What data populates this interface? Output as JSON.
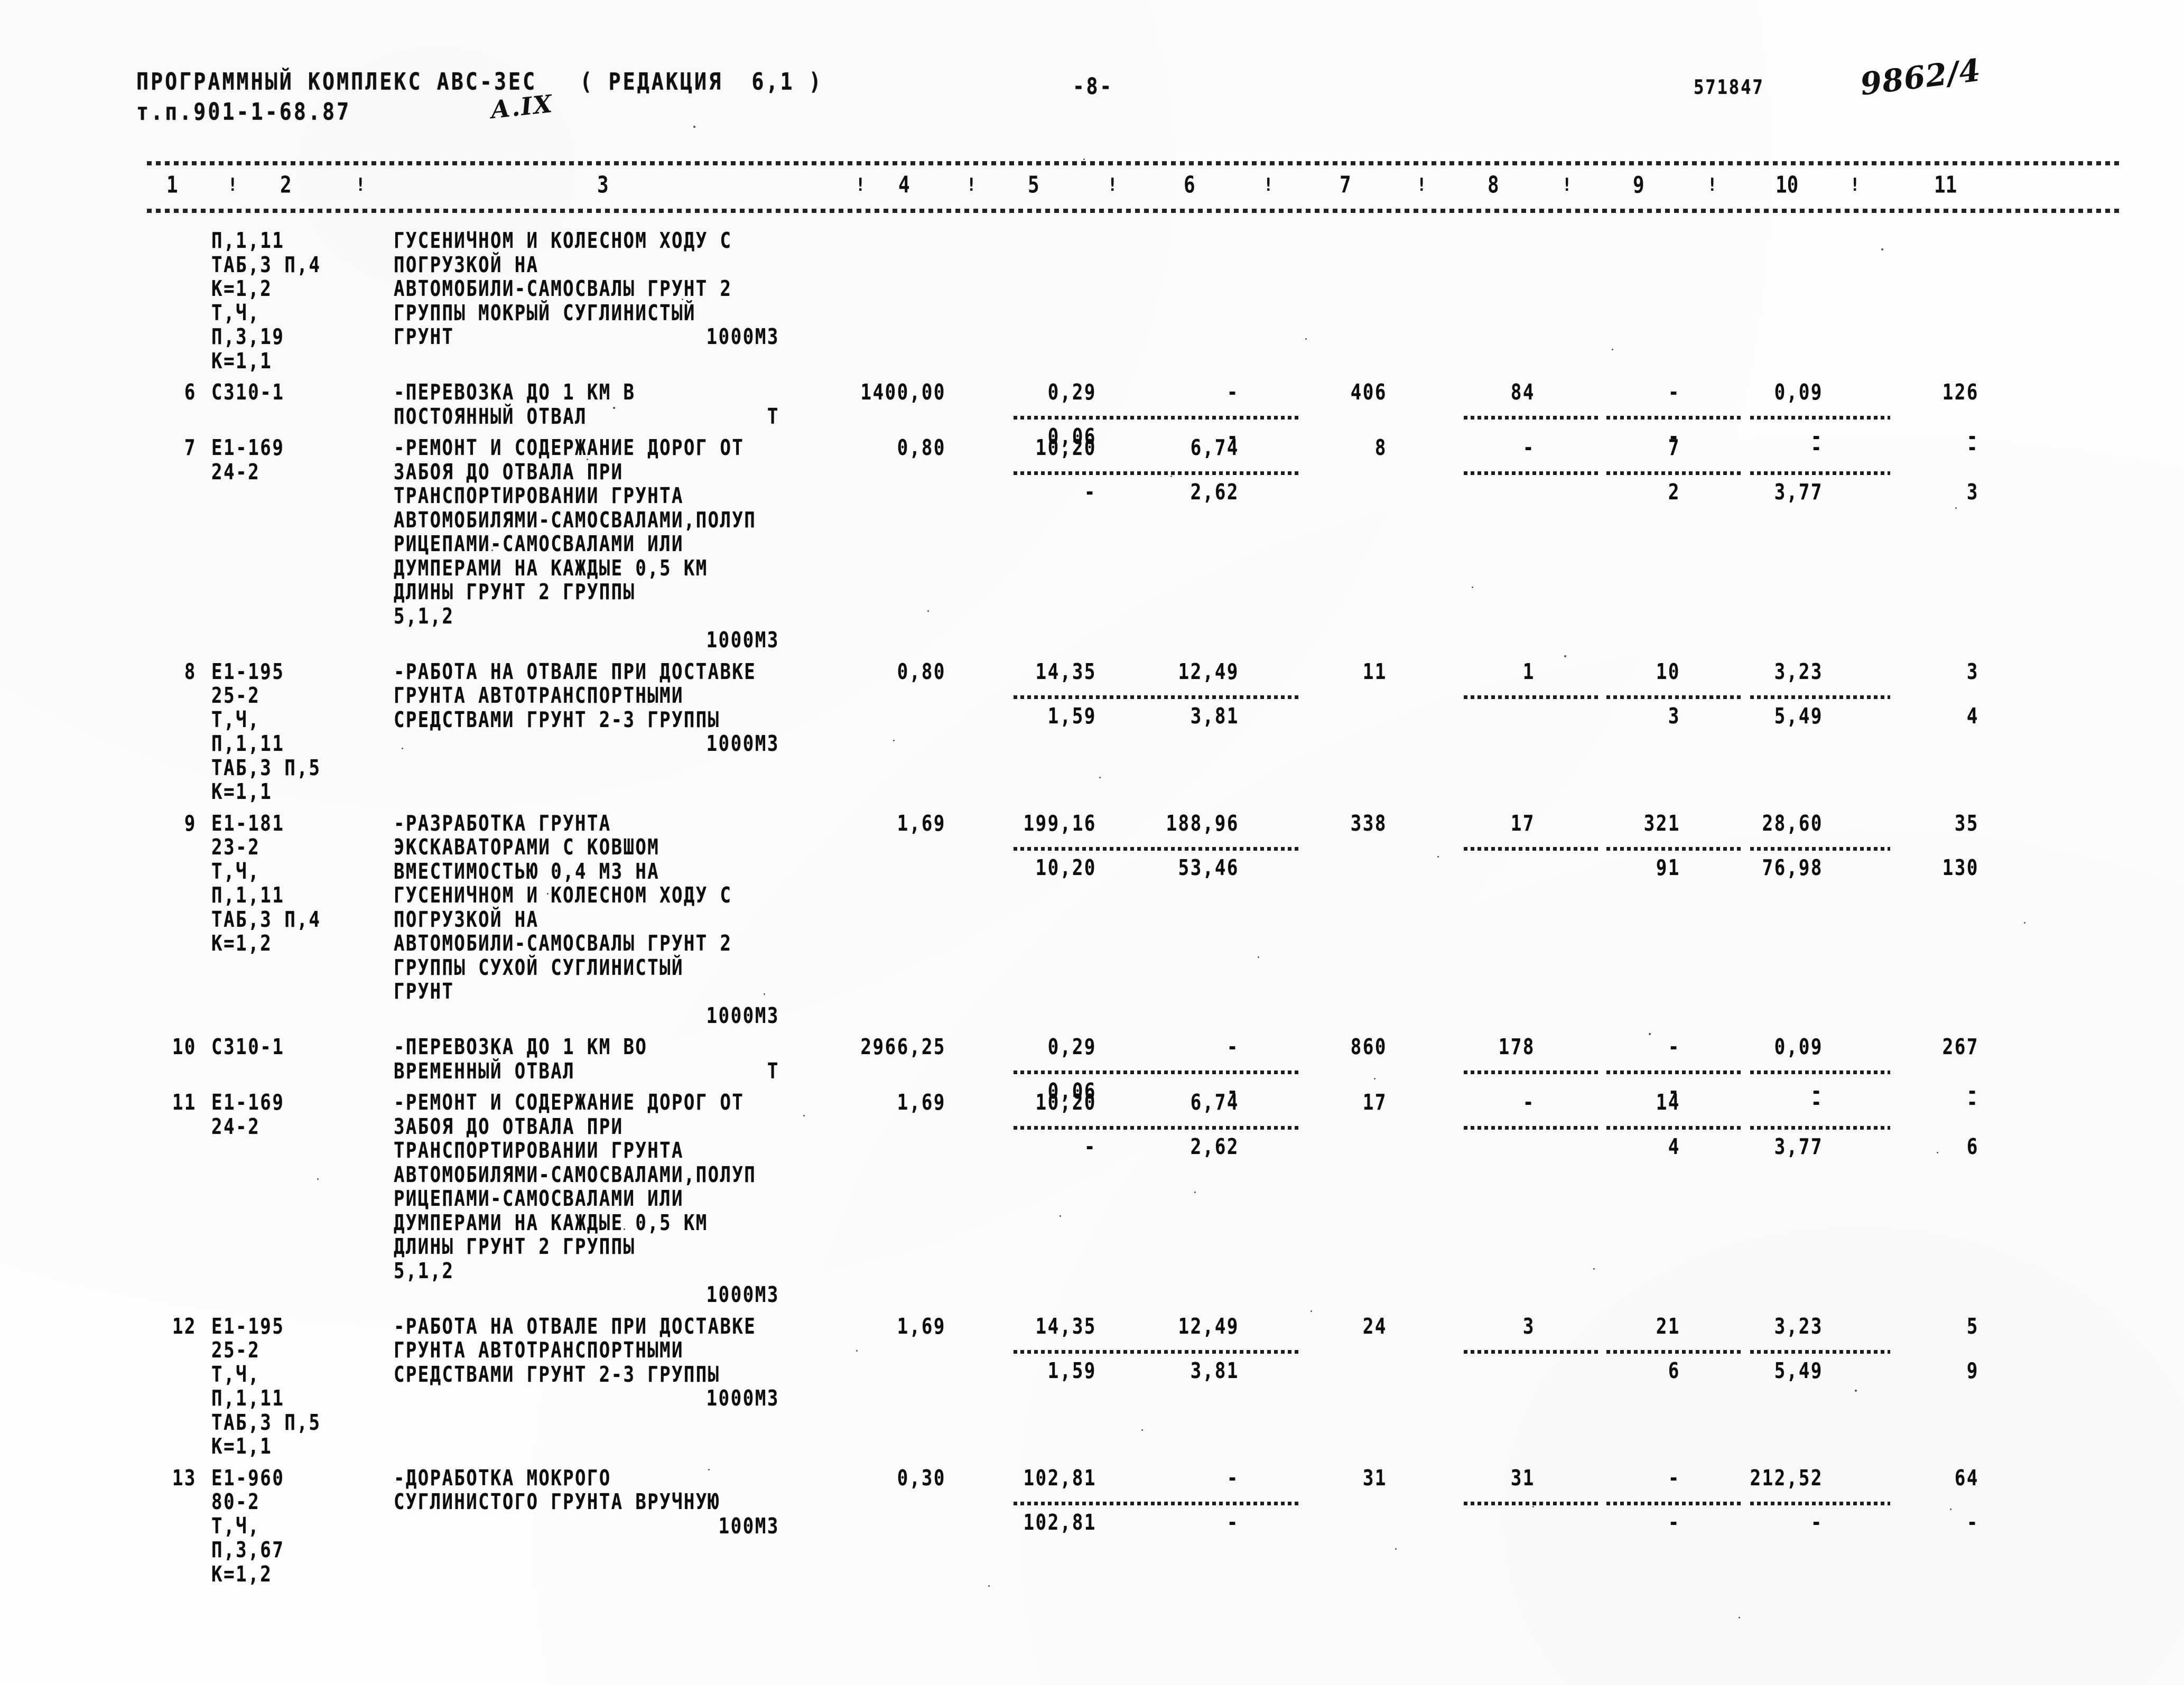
{
  "header": {
    "program_title": "ПРОГРАММНЫЙ КОМПЛЕКС АВС-ЗЕС   ( РЕДАКЦИЯ  6,1 )",
    "project_code": "т.п.901-1-68.87",
    "handwritten_section": "А.IX",
    "page_label": "-8-",
    "doc_number": "571847",
    "handwritten_number": "9862/4"
  },
  "columns": {
    "numbers": [
      "1",
      "2",
      "3",
      "4",
      "5",
      "6",
      "7",
      "8",
      "9",
      "10",
      "11"
    ],
    "separator": "!"
  },
  "rows": [
    {
      "no": "",
      "code_lines": [
        "П,1,11",
        "ТАБ,3 П,4",
        "К=1,2",
        "Т,Ч,",
        "П,3,19",
        "К=1,1"
      ],
      "desc_lines": [
        "ГУСЕНИЧНОМ И КОЛЕСНОМ ХОДУ С",
        "ПОГРУЗКОЙ НА",
        "АВТОМОБИЛИ-САМОСВАЛЫ ГРУНТ 2",
        "ГРУППЫ МОКРЫЙ СУГЛИНИСТЫЙ",
        "ГРУНТ",
        ""
      ],
      "unit": "1000М3",
      "unit_line": 5,
      "values": [],
      "sub_values": [],
      "has_rules": false
    },
    {
      "no": "6",
      "code_lines": [
        "С310-1"
      ],
      "desc_lines": [
        "-ПЕРЕВОЗКА ДО 1 КМ В",
        "ПОСТОЯННЫЙ ОТВАЛ"
      ],
      "unit": "Т",
      "unit_line": 2,
      "values": [
        "1400,00",
        "0,29",
        "-",
        "406",
        "84",
        "-",
        "0,09",
        "126"
      ],
      "sub_values": [
        "",
        "0,06",
        "-",
        "",
        "",
        "-",
        "-",
        "-"
      ],
      "has_rules": true
    },
    {
      "no": "7",
      "code_lines": [
        "Е1-169",
        "24-2"
      ],
      "desc_lines": [
        "-РЕМОНТ И СОДЕРЖАНИЕ ДОРОГ ОТ",
        "ЗАБОЯ ДО ОТВАЛА ПРИ",
        "ТРАНСПОРТИРОВАНИИ ГРУНТА",
        "АВТОМОБИЛЯМИ-САМОСВАЛАМИ,ПОЛУП",
        "РИЦЕПАМИ-САМОСВАЛАМИ ИЛИ",
        "ДУМПЕРАМИ НА КАЖДЫЕ 0,5 КМ",
        "ДЛИНЫ ГРУНТ 2 ГРУППЫ",
        "5,1,2"
      ],
      "unit": "1000М3",
      "unit_line": 9,
      "values": [
        "0,80",
        "10,20",
        "6,74",
        "8",
        "-",
        "7",
        "-",
        "-"
      ],
      "sub_values": [
        "",
        "-",
        "2,62",
        "",
        "",
        "2",
        "3,77",
        "3"
      ],
      "has_rules": true
    },
    {
      "no": "8",
      "code_lines": [
        "Е1-195",
        "25-2",
        "Т,Ч,",
        "П,1,11",
        "ТАБ,3 П,5",
        "К=1,1"
      ],
      "desc_lines": [
        "-РАБОТА НА ОТВАЛЕ ПРИ ДОСТАВКЕ",
        "ГРУНТА АВТОТРАНСПОРТНЫМИ",
        "СРЕДСТВАМИ ГРУНТ 2-3 ГРУППЫ",
        "",
        "",
        ""
      ],
      "unit": "1000М3",
      "unit_line": 4,
      "values": [
        "0,80",
        "14,35",
        "12,49",
        "11",
        "1",
        "10",
        "3,23",
        "3"
      ],
      "sub_values": [
        "",
        "1,59",
        "3,81",
        "",
        "",
        "3",
        "5,49",
        "4"
      ],
      "has_rules": true
    },
    {
      "no": "9",
      "code_lines": [
        "Е1-181",
        "23-2",
        "Т,Ч,",
        "П,1,11",
        "ТАБ,3 П,4",
        "К=1,2"
      ],
      "desc_lines": [
        "-РАЗРАБОТКА ГРУНТА",
        "ЭКСКАВАТОРАМИ С КОВШОМ",
        "ВМЕСТИМОСТЬЮ 0,4 М3 НА",
        "ГУСЕНИЧНОМ И КОЛЕСНОМ ХОДУ С",
        "ПОГРУЗКОЙ НА",
        "АВТОМОБИЛИ-САМОСВАЛЫ ГРУНТ 2",
        "ГРУППЫ СУХОЙ СУГЛИНИСТЫЙ",
        "ГРУНТ"
      ],
      "unit": "1000М3",
      "unit_line": 9,
      "values": [
        "1,69",
        "199,16",
        "188,96",
        "338",
        "17",
        "321",
        "28,60",
        "35"
      ],
      "sub_values": [
        "",
        "10,20",
        "53,46",
        "",
        "",
        "91",
        "76,98",
        "130"
      ],
      "has_rules": true
    },
    {
      "no": "10",
      "code_lines": [
        "С310-1"
      ],
      "desc_lines": [
        "-ПЕРЕВОЗКА ДО 1 КМ ВО",
        "ВРЕМЕННЫЙ ОТВАЛ"
      ],
      "unit": "Т",
      "unit_line": 2,
      "values": [
        "2966,25",
        "0,29",
        "-",
        "860",
        "178",
        "-",
        "0,09",
        "267"
      ],
      "sub_values": [
        "",
        "0,06",
        "-",
        "",
        "",
        "-",
        "-",
        "-"
      ],
      "has_rules": true
    },
    {
      "no": "11",
      "code_lines": [
        "Е1-169",
        "24-2"
      ],
      "desc_lines": [
        "-РЕМОНТ И СОДЕРЖАНИЕ ДОРОГ ОТ",
        "ЗАБОЯ ДО ОТВАЛА ПРИ",
        "ТРАНСПОРТИРОВАНИИ ГРУНТА",
        "АВТОМОБИЛЯМИ-САМОСВАЛАМИ,ПОЛУП",
        "РИЦЕПАМИ-САМОСВАЛАМИ ИЛИ",
        "ДУМПЕРАМИ НА КАЖДЫЕ 0,5 КМ",
        "ДЛИНЫ ГРУНТ 2 ГРУППЫ",
        "5,1,2"
      ],
      "unit": "1000М3",
      "unit_line": 9,
      "values": [
        "1,69",
        "10,20",
        "6,74",
        "17",
        "-",
        "14",
        "-",
        "-"
      ],
      "sub_values": [
        "",
        "-",
        "2,62",
        "",
        "",
        "4",
        "3,77",
        "6"
      ],
      "has_rules": true
    },
    {
      "no": "12",
      "code_lines": [
        "Е1-195",
        "25-2",
        "Т,Ч,",
        "П,1,11",
        "ТАБ,3 П,5",
        "К=1,1"
      ],
      "desc_lines": [
        "-РАБОТА НА ОТВАЛЕ ПРИ ДОСТАВКЕ",
        "ГРУНТА АВТОТРАНСПОРТНЫМИ",
        "СРЕДСТВАМИ ГРУНТ 2-3 ГРУППЫ",
        "",
        "",
        ""
      ],
      "unit": "1000М3",
      "unit_line": 4,
      "values": [
        "1,69",
        "14,35",
        "12,49",
        "24",
        "3",
        "21",
        "3,23",
        "5"
      ],
      "sub_values": [
        "",
        "1,59",
        "3,81",
        "",
        "",
        "6",
        "5,49",
        "9"
      ],
      "has_rules": true
    },
    {
      "no": "13",
      "code_lines": [
        "Е1-960",
        "80-2",
        "Т,Ч,",
        "П,3,67",
        "К=1,2"
      ],
      "desc_lines": [
        "-ДОРАБОТКА МОКРОГО",
        "СУГЛИНИСТОГО ГРУНТА ВРУЧНУЮ",
        "",
        "",
        ""
      ],
      "unit": "100М3",
      "unit_line": 3,
      "values": [
        "0,30",
        "102,81",
        "-",
        "31",
        "31",
        "-",
        "212,52",
        "64"
      ],
      "sub_values": [
        "",
        "102,81",
        "-",
        "",
        "",
        "-",
        "-",
        "-"
      ],
      "has_rules": true
    }
  ]
}
